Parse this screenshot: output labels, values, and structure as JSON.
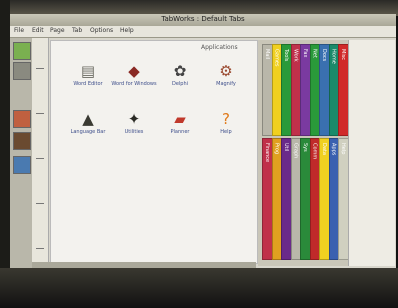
{
  "window": {
    "title": "TabWorks : Default Tabs"
  },
  "menu": [
    "File",
    "Edit",
    "Page",
    "Tab",
    "Options",
    "Help"
  ],
  "page": {
    "title": "Applications",
    "icons": [
      {
        "label": "Word Editor",
        "glyph": "▤",
        "color": "#6b6b62"
      },
      {
        "label": "Word for Windows",
        "glyph": "◆",
        "color": "#8a2a24"
      },
      {
        "label": "Delphi",
        "glyph": "✿",
        "color": "#444444"
      },
      {
        "label": "Magnify",
        "glyph": "⚙",
        "color": "#9a4a30"
      },
      {
        "label": "Language Bar",
        "glyph": "▲",
        "color": "#3a3a32"
      },
      {
        "label": "Utilities",
        "glyph": "✦",
        "color": "#2a2a24"
      },
      {
        "label": "Planner",
        "glyph": "▰",
        "color": "#c0392b"
      },
      {
        "label": "Help",
        "glyph": "?",
        "color": "#e07a1a"
      }
    ]
  },
  "tabs": {
    "top": [
      {
        "label": "Mail",
        "color": "#b9b7aa"
      },
      {
        "label": "Games",
        "color": "#f0d020"
      },
      {
        "label": "Tools",
        "color": "#2a9a3a"
      },
      {
        "label": "Work",
        "color": "#c0304a"
      },
      {
        "label": "Fax",
        "color": "#7a3aa0"
      },
      {
        "label": "Net",
        "color": "#2a9a3a"
      },
      {
        "label": "Docs",
        "color": "#3a70b0"
      },
      {
        "label": "Home",
        "color": "#1a8a6a"
      },
      {
        "label": "Misc",
        "color": "#d02a2a"
      }
    ],
    "bottom": [
      {
        "label": "Finance",
        "color": "#c0304a"
      },
      {
        "label": "Prog",
        "color": "#e0a020"
      },
      {
        "label": "Util",
        "color": "#6a2a8a"
      },
      {
        "label": "Graph",
        "color": "#b9b7aa"
      },
      {
        "label": "Sys",
        "color": "#2a8a3a"
      },
      {
        "label": "Comm",
        "color": "#c02a2a"
      },
      {
        "label": "Data",
        "color": "#f0d020"
      },
      {
        "label": "Apps",
        "color": "#3a60b0"
      },
      {
        "label": "Help",
        "color": "#d0d0c0"
      }
    ]
  },
  "tools": [
    {
      "name": "tool-green-icon",
      "color": "#7ab050"
    },
    {
      "name": "tool-gray-icon",
      "color": "#8a8a80"
    },
    {
      "name": "tool-orange-icon",
      "color": "#c06040"
    },
    {
      "name": "tool-brown-icon",
      "color": "#6a4a30"
    },
    {
      "name": "tool-blue-icon",
      "color": "#4a7ab0"
    }
  ]
}
